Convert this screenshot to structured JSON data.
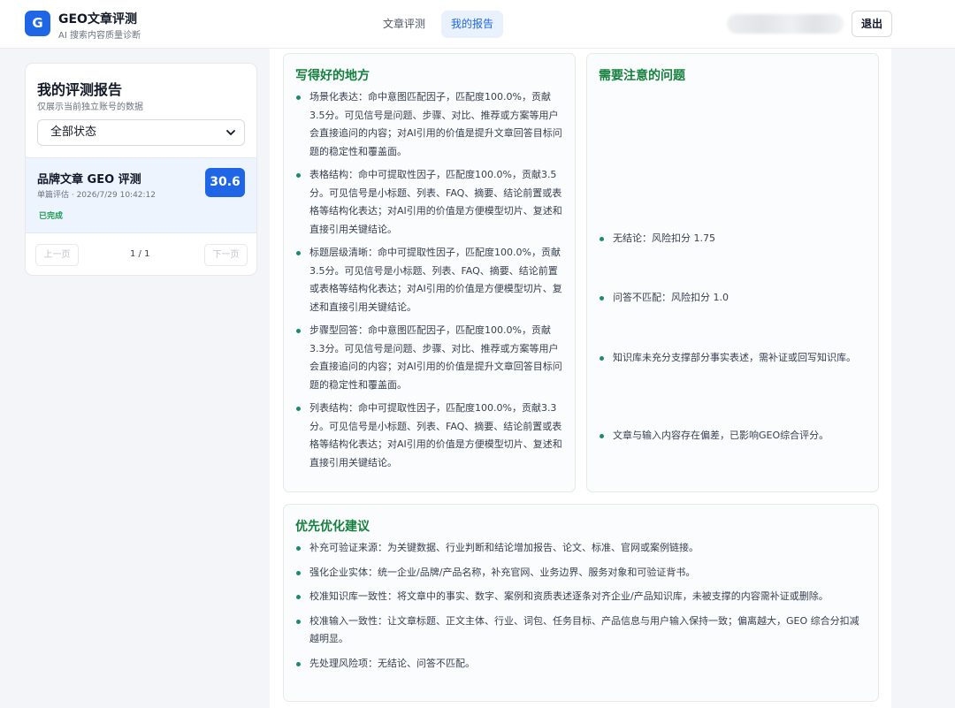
{
  "app": {
    "logo_letter": "G",
    "title": "GEO文章评测",
    "subtitle": "AI 搜索内容质量诊断"
  },
  "nav": {
    "tabs": [
      {
        "label": "文章评测",
        "active": false
      },
      {
        "label": "我的报告",
        "active": true
      }
    ],
    "logout_label": "退出"
  },
  "sidebar": {
    "title": "我的评测报告",
    "subtitle": "仅展示当前独立账号的数据",
    "filter": {
      "selected": "全部状态"
    },
    "items": [
      {
        "title": "品牌文章 GEO 评测",
        "meta": "单篇评估 · 2026/7/29 10:42:12",
        "status": "已完成",
        "score": "30.6"
      }
    ],
    "pager": {
      "prev": "上一页",
      "info": "1 / 1",
      "next": "下一页"
    }
  },
  "report": {
    "good": {
      "title": "写得好的地方",
      "items": [
        "场景化表达：命中意图匹配因子，匹配度100.0%，贡献3.5分。可见信号是问题、步骤、对比、推荐或方案等用户会直接追问的内容；对AI引用的价值是提升文章回答目标问题的稳定性和覆盖面。",
        "表格结构：命中可提取性因子，匹配度100.0%，贡献3.5分。可见信号是小标题、列表、FAQ、摘要、结论前置或表格等结构化表达；对AI引用的价值是方便模型切片、复述和直接引用关键结论。",
        "标题层级清晰：命中可提取性因子，匹配度100.0%，贡献3.5分。可见信号是小标题、列表、FAQ、摘要、结论前置或表格等结构化表达；对AI引用的价值是方便模型切片、复述和直接引用关键结论。",
        "步骤型回答：命中意图匹配因子，匹配度100.0%，贡献3.3分。可见信号是问题、步骤、对比、推荐或方案等用户会直接追问的内容；对AI引用的价值是提升文章回答目标问题的稳定性和覆盖面。",
        "列表结构：命中可提取性因子，匹配度100.0%，贡献3.3分。可见信号是小标题、列表、FAQ、摘要、结论前置或表格等结构化表达；对AI引用的价值是方便模型切片、复述和直接引用关键结论。"
      ]
    },
    "issues": {
      "title": "需要注意的问题",
      "items": [
        "无结论：风险扣分 1.75",
        "问答不匹配：风险扣分 1.0",
        "知识库未充分支撑部分事实表述，需补证或回写知识库。",
        "文章与输入内容存在偏差，已影响GEO综合评分。"
      ]
    },
    "optimize": {
      "title": "优先优化建议",
      "items": [
        "补充可验证来源：为关键数据、行业判断和结论增加报告、论文、标准、官网或案例链接。",
        "强化企业实体：统一企业/品牌/产品名称，补充官网、业务边界、服务对象和可验证背书。",
        "校准知识库一致性：将文章中的事实、数字、案例和资质表述逐条对齐企业/产品知识库，未被支撑的内容需补证或删除。",
        "校准输入一致性：让文章标题、正文主体、行业、词包、任务目标、产品信息与用户输入保持一致；偏离越大，GEO 综合分扣减越明显。",
        "先处理风险项：无结论、问答不匹配。"
      ]
    }
  }
}
